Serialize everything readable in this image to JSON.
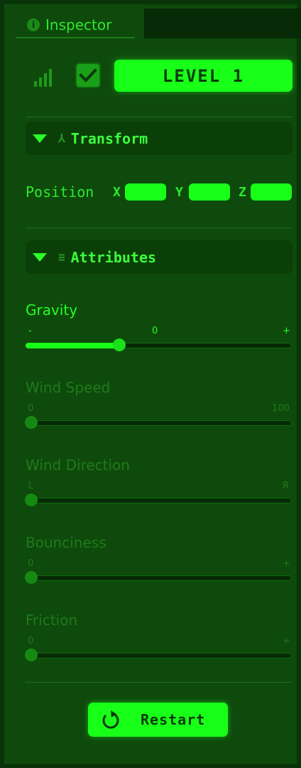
{
  "tab": {
    "label": "Inspector"
  },
  "level": {
    "label": "LEVEL 1"
  },
  "checkbox": {
    "checked": true
  },
  "sections": {
    "transform": "Transform",
    "attributes": "Attributes"
  },
  "position": {
    "label": "Position",
    "x_label": "X",
    "y_label": "Y",
    "z_label": "Z",
    "x_value": "",
    "y_value": "",
    "z_value": ""
  },
  "sliders": [
    {
      "label": "Gravity",
      "min_label": "-",
      "mid_label": "0",
      "max_label": "+",
      "value_fraction": 0.33,
      "enabled": true
    },
    {
      "label": "Wind Speed",
      "min_label": "0",
      "max_label": "100",
      "value_fraction": 0.0,
      "enabled": false
    },
    {
      "label": "Wind Direction",
      "min_label": "L",
      "max_label": "R",
      "value_fraction": 0.0,
      "enabled": false
    },
    {
      "label": "Bounciness",
      "min_label": "0",
      "max_label": "+",
      "value_fraction": 0.0,
      "enabled": false
    },
    {
      "label": "Friction",
      "min_label": "0",
      "max_label": "+",
      "value_fraction": 0.0,
      "enabled": false
    }
  ],
  "restart": {
    "label": "Restart"
  },
  "colors": {
    "accent": "#18ff18",
    "background": "#0e4a0c",
    "disabled": "#1f7a1a"
  }
}
